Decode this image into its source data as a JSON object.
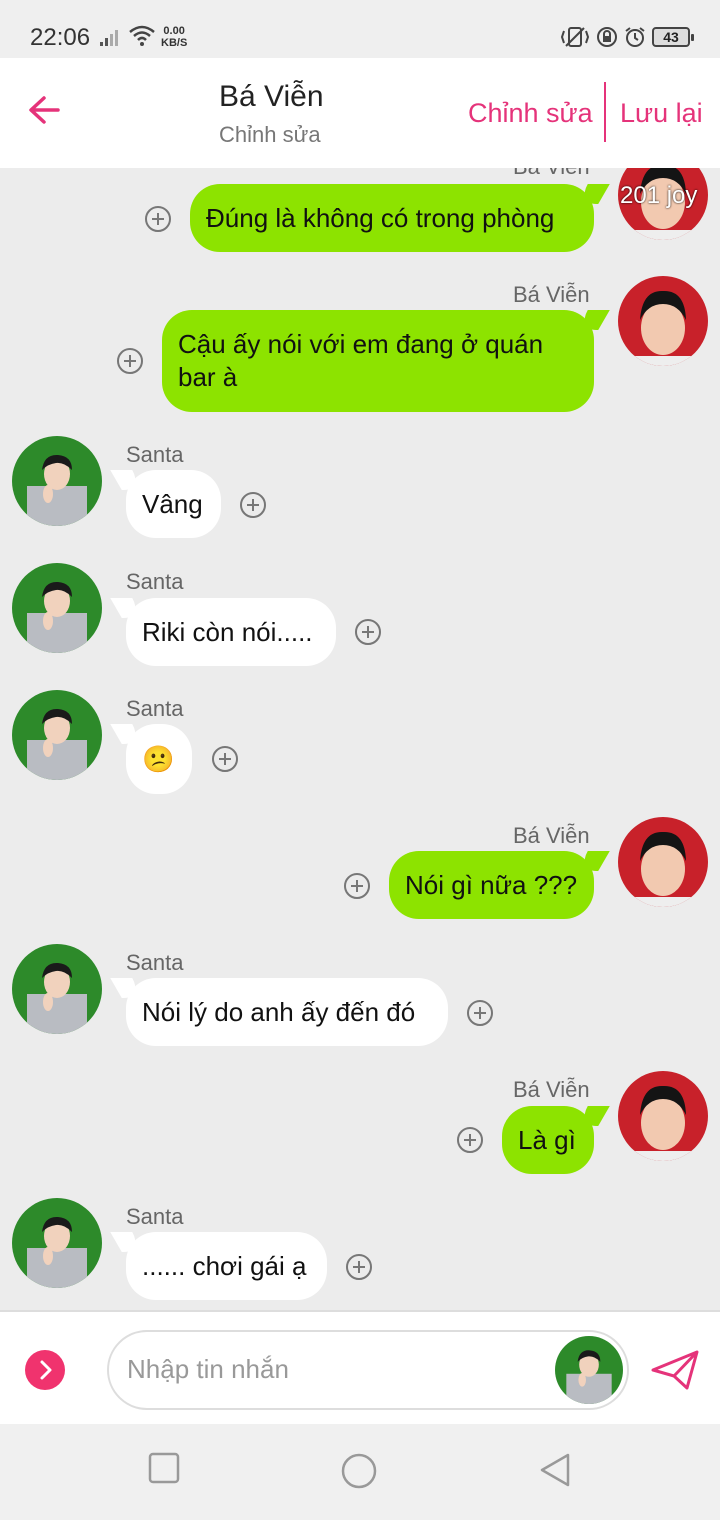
{
  "status_bar": {
    "time": "22:06",
    "net_speed_value": "0.00",
    "net_speed_unit": "KB/S",
    "battery": "43",
    "icons": [
      "signal-icon",
      "wifi-icon",
      "vibrate-icon",
      "rotation-lock-icon",
      "alarm-icon",
      "battery-icon"
    ]
  },
  "header": {
    "title": "Bá Viễn",
    "subtitle": "Chỉnh sửa",
    "edit_label": "Chỉnh sửa",
    "save_label": "Lưu lại"
  },
  "chat": {
    "top_badge": "201 joy",
    "messages": [
      {
        "sender": "Bá Viễn",
        "side": "right",
        "text": "Đúng là không có trong phòng"
      },
      {
        "sender": "Bá Viễn",
        "side": "right",
        "text": "Cậu ấy nói với em đang ở quán bar à"
      },
      {
        "sender": "Santa",
        "side": "left",
        "text": "Vâng"
      },
      {
        "sender": "Santa",
        "side": "left",
        "text": "Riki còn nói....."
      },
      {
        "sender": "Santa",
        "side": "left",
        "text": "😕"
      },
      {
        "sender": "Bá Viễn",
        "side": "right",
        "text": "Nói gì nữa ???"
      },
      {
        "sender": "Santa",
        "side": "left",
        "text": "Nói lý do anh ấy đến đó"
      },
      {
        "sender": "Bá Viễn",
        "side": "right",
        "text": "Là gì"
      },
      {
        "sender": "Santa",
        "side": "left",
        "text": "...... chơi gái ạ"
      }
    ]
  },
  "input": {
    "placeholder": "Nhập tin nhắn"
  },
  "colors": {
    "accent": "#e5337a",
    "my_bubble": "#8de300",
    "their_bubble": "#ffffff",
    "background": "#ececec"
  }
}
